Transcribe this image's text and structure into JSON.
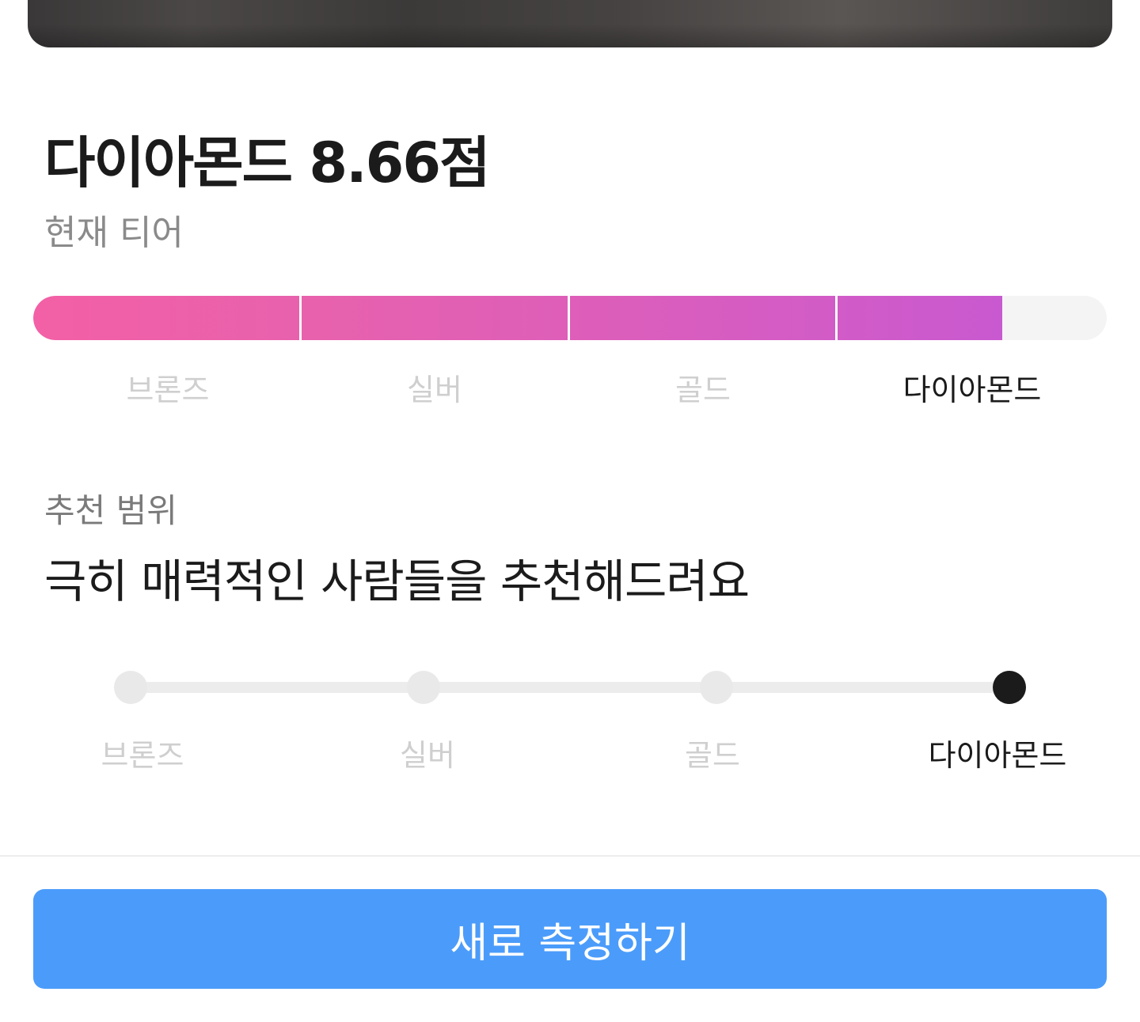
{
  "score": {
    "title": "다이아몬드 8.66점",
    "caption": "현재 티어",
    "progress_percent": 90.3
  },
  "tiers": [
    "브론즈",
    "실버",
    "골드",
    "다이아몬드"
  ],
  "current_tier_index": 3,
  "recommendation": {
    "caption": "추천 범위",
    "headline": "극히 매력적인 사람들을 추천해드려요",
    "labels": [
      "브론즈",
      "실버",
      "골드",
      "다이아몬드"
    ],
    "selected_index": 3
  },
  "cta": {
    "label": "새로 측정하기"
  },
  "colors": {
    "accent_gradient_start": "#f360a6",
    "accent_gradient_end": "#c959d0",
    "button": "#4b9cfa",
    "active_text": "#1b1b1b",
    "inactive_text": "#cfcfcf"
  }
}
